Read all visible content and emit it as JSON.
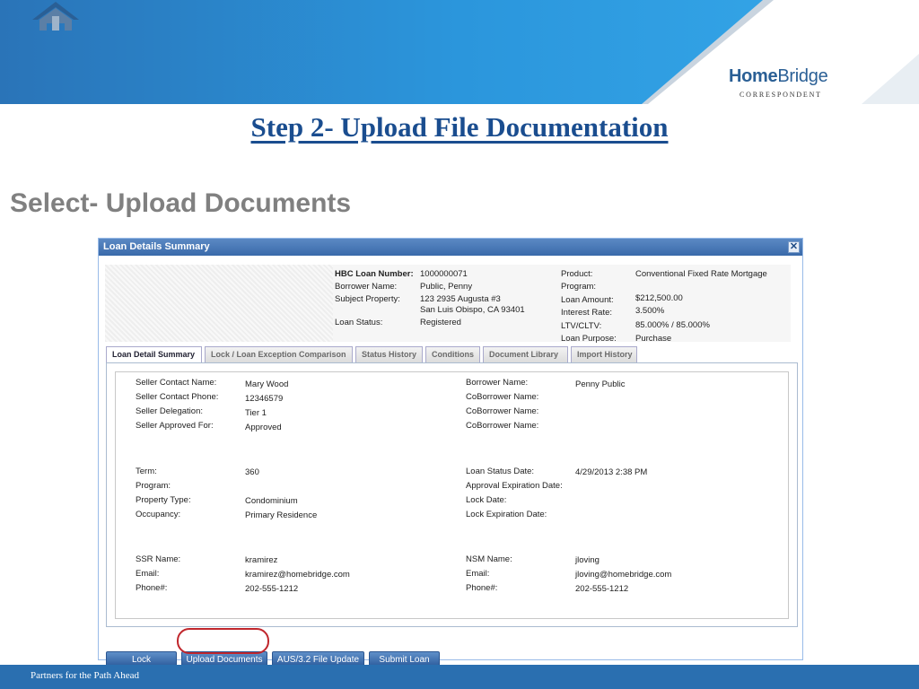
{
  "branding": {
    "logo_part1": "Home",
    "logo_part2": "Bridge",
    "logo_sub": "CORRESPONDENT",
    "colors": {
      "header_blue": "#2a8fd6",
      "footer_blue": "#2a6fb0",
      "title_blue": "#1a4d8f",
      "highlight_red": "#c0262c"
    }
  },
  "slide": {
    "title": "Step 2- Upload File Documentation",
    "subtitle": "Select- Upload Documents"
  },
  "dialog": {
    "title": "Loan Details Summary",
    "close_icon": "close-icon",
    "info": {
      "hbc_label": "HBC Loan Number:",
      "hbc_value": "1000000071",
      "borrower_label": "Borrower Name:",
      "borrower_value": "Public, Penny",
      "property_label": "Subject Property:",
      "property_line1": "123 2935 Augusta #3",
      "property_line2": "San Luis Obispo, CA 93401",
      "status_label": "Loan Status:",
      "status_value": "Registered",
      "product_label": "Product:",
      "product_value": "Conventional Fixed Rate Mortgage",
      "program_label": "Program:",
      "program_value": "",
      "amount_label": "Loan Amount:",
      "amount_value": "$212,500.00",
      "rate_label": "Interest Rate:",
      "rate_value": "3.500%",
      "ltv_label": "LTV/CLTV:",
      "ltv_value": "85.000% / 85.000%",
      "purpose_label": "Loan Purpose:",
      "purpose_value": "Purchase"
    },
    "tabs": [
      "Loan Detail Summary",
      "Lock / Loan Exception Comparison",
      "Status History",
      "Conditions",
      "Document Library",
      "Import History"
    ],
    "details": {
      "seller_contact_name_label": "Seller Contact Name:",
      "seller_contact_name": "Mary Wood",
      "seller_contact_phone_label": "Seller Contact Phone:",
      "seller_contact_phone": "12346579",
      "seller_delegation_label": "Seller Delegation:",
      "seller_delegation": "Tier 1",
      "seller_approved_label": "Seller Approved For:",
      "seller_approved": "Approved",
      "borrower_name_label": "Borrower Name:",
      "borrower_name": "Penny Public",
      "coborrower_label": "CoBorrower Name:",
      "term_label": "Term:",
      "term": "360",
      "program_label": "Program:",
      "property_type_label": "Property Type:",
      "property_type": "Condominium",
      "occupancy_label": "Occupancy:",
      "occupancy": "Primary Residence",
      "loan_status_date_label": "Loan Status Date:",
      "loan_status_date": "4/29/2013 2:38 PM",
      "approval_exp_label": "Approval Expiration Date:",
      "lock_date_label": "Lock Date:",
      "lock_exp_label": "Lock Expiration Date:",
      "ssr_name_label": "SSR Name:",
      "ssr_name": "kramirez",
      "email_label": "Email:",
      "ssr_email": "kramirez@homebridge.com",
      "phone_label": "Phone#:",
      "ssr_phone": "202-555-1212",
      "nsm_name_label": "NSM Name:",
      "nsm_name": "jloving",
      "nsm_email": "jloving@homebridge.com",
      "nsm_phone": "202-555-1212"
    },
    "buttons": {
      "lock": "Lock",
      "upload": "Upload Documents",
      "aus": "AUS/3.2 File Update",
      "submit": "Submit Loan"
    }
  },
  "footer": {
    "text": "Partners for the Path Ahead"
  }
}
